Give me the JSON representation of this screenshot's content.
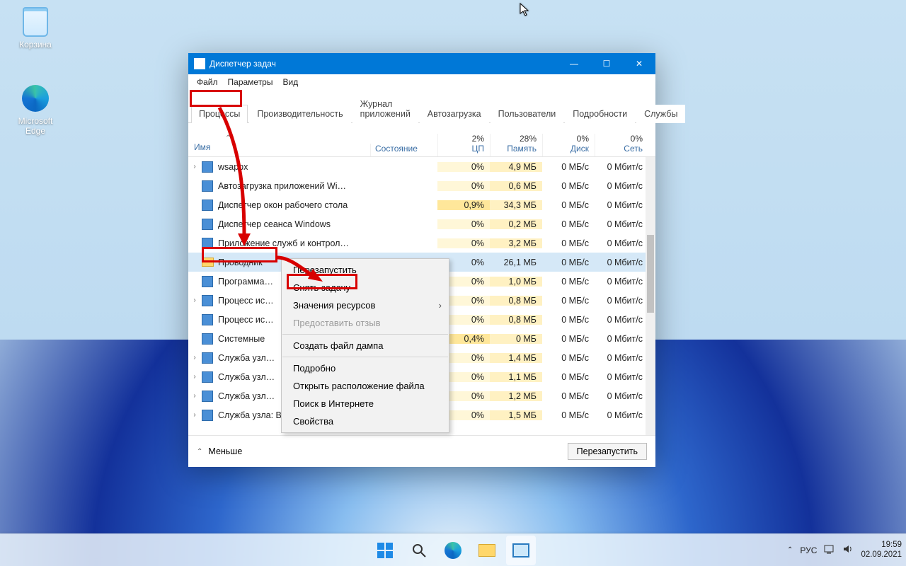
{
  "desktop": {
    "recycle_label": "Корзина",
    "edge_label": "Microsoft Edge"
  },
  "window": {
    "title": "Диспетчер задач",
    "menu": {
      "file": "Файл",
      "options": "Параметры",
      "view": "Вид"
    },
    "tabs": {
      "processes": "Процессы",
      "performance": "Производительность",
      "app_history": "Журнал приложений",
      "startup": "Автозагрузка",
      "users": "Пользователи",
      "details": "Подробности",
      "services": "Службы"
    },
    "columns": {
      "name": "Имя",
      "state": "Состояние",
      "cpu_pct": "2%",
      "cpu": "ЦП",
      "mem_pct": "28%",
      "mem": "Память",
      "disk_pct": "0%",
      "disk": "Диск",
      "net_pct": "0%",
      "net": "Сеть"
    },
    "rows": [
      {
        "exp": true,
        "icon": "sys",
        "name": "wsappx",
        "cpu": "0%",
        "mem": "4,9 МБ",
        "disk": "0 МБ/с",
        "net": "0 Мбит/с"
      },
      {
        "exp": false,
        "icon": "sys",
        "name": "Автозагрузка приложений Wi…",
        "cpu": "0%",
        "mem": "0,6 МБ",
        "disk": "0 МБ/с",
        "net": "0 Мбит/с"
      },
      {
        "exp": false,
        "icon": "sys",
        "name": "Диспетчер окон рабочего стола",
        "cpu": "0,9%",
        "mem": "34,3 МБ",
        "disk": "0 МБ/с",
        "net": "0 Мбит/с"
      },
      {
        "exp": false,
        "icon": "sys",
        "name": "Диспетчер сеанса  Windows",
        "cpu": "0%",
        "mem": "0,2 МБ",
        "disk": "0 МБ/с",
        "net": "0 Мбит/с"
      },
      {
        "exp": false,
        "icon": "sys",
        "name": "Приложение служб и контрол…",
        "cpu": "0%",
        "mem": "3,2 МБ",
        "disk": "0 МБ/с",
        "net": "0 Мбит/с"
      },
      {
        "exp": false,
        "icon": "fold",
        "name": "Проводник",
        "cpu": "0%",
        "mem": "26,1 МБ",
        "disk": "0 МБ/с",
        "net": "0 Мбит/с",
        "hl": true
      },
      {
        "exp": false,
        "icon": "sys",
        "name": "Программа…",
        "cpu": "0%",
        "mem": "1,0 МБ",
        "disk": "0 МБ/с",
        "net": "0 Мбит/с"
      },
      {
        "exp": true,
        "icon": "sys",
        "name": "Процесс ис…",
        "cpu": "0%",
        "mem": "0,8 МБ",
        "disk": "0 МБ/с",
        "net": "0 Мбит/с"
      },
      {
        "exp": false,
        "icon": "sys",
        "name": "Процесс ис…",
        "cpu": "0%",
        "mem": "0,8 МБ",
        "disk": "0 МБ/с",
        "net": "0 Мбит/с"
      },
      {
        "exp": false,
        "icon": "sys",
        "name": "Системные",
        "cpu": "0,4%",
        "mem": "0 МБ",
        "disk": "0 МБ/с",
        "net": "0 Мбит/с"
      },
      {
        "exp": true,
        "icon": "sys",
        "name": "Служба узл…",
        "cpu": "0%",
        "mem": "1,4 МБ",
        "disk": "0 МБ/с",
        "net": "0 Мбит/с"
      },
      {
        "exp": true,
        "icon": "sys",
        "name": "Служба узл…",
        "cpu": "0%",
        "mem": "1,1 МБ",
        "disk": "0 МБ/с",
        "net": "0 Мбит/с"
      },
      {
        "exp": true,
        "icon": "sys",
        "name": "Служба узл…",
        "cpu": "0%",
        "mem": "1,2 МБ",
        "disk": "0 МБ/с",
        "net": "0 Мбит/с"
      },
      {
        "exp": true,
        "icon": "sys",
        "name": "Служба узла: Вспомогательна…",
        "cpu": "0%",
        "mem": "1,5 МБ",
        "disk": "0 МБ/с",
        "net": "0 Мбит/с"
      }
    ],
    "context": {
      "restart": "Перезапустить",
      "end_task": "Снять задачу",
      "resource_values": "Значения ресурсов",
      "feedback": "Предоставить отзыв",
      "create_dump": "Создать файл дампа",
      "details": "Подробно",
      "open_location": "Открыть расположение файла",
      "search_online": "Поиск в Интернете",
      "properties": "Свойства"
    },
    "footer": {
      "fewer": "Меньше",
      "restart_btn": "Перезапустить"
    }
  },
  "taskbar": {
    "lang": "РУС",
    "time": "19:59",
    "date": "02.09.2021"
  }
}
